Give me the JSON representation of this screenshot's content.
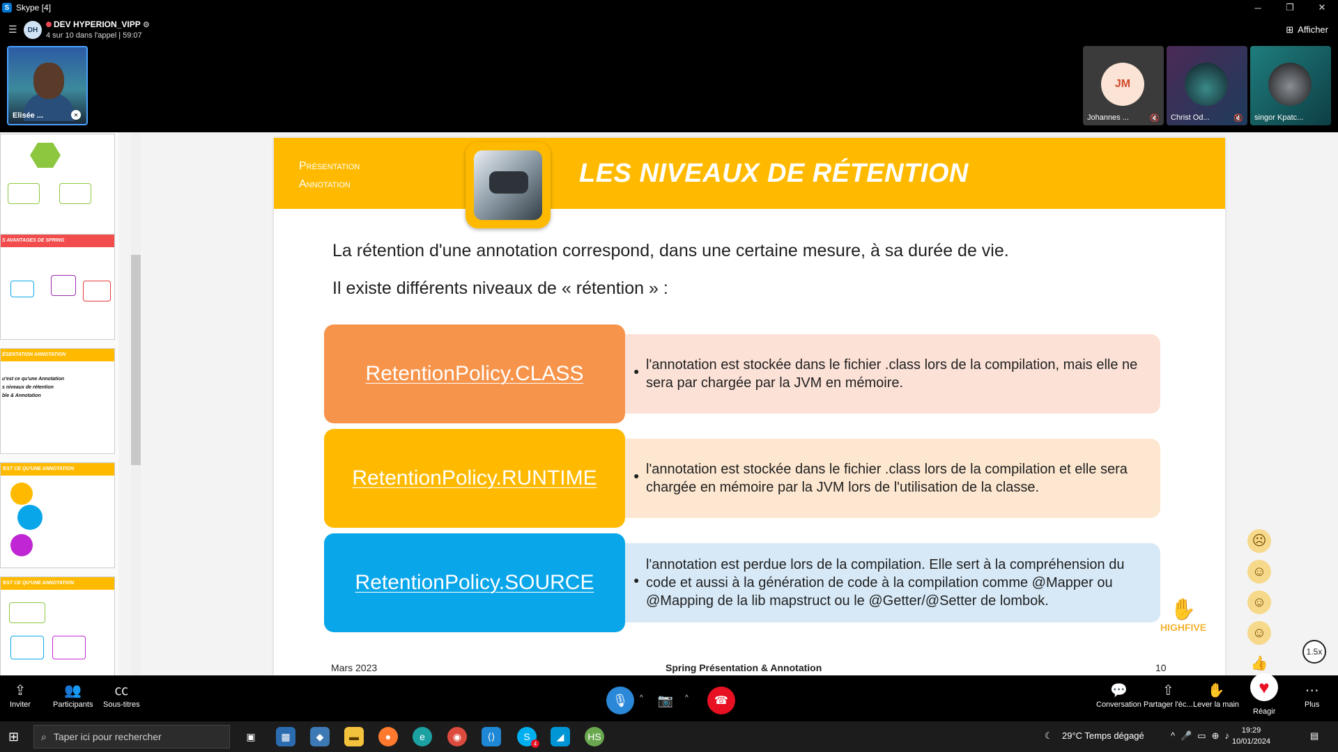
{
  "window": {
    "title": "Skype [4]",
    "controls": [
      "─",
      "❐",
      "✕"
    ]
  },
  "call": {
    "group_avatar": "DH",
    "group_name": "DEV HYPERION_VIPP",
    "status": "4 sur 10 dans l'appel | 59:07",
    "view_button": "Afficher",
    "self_tile_label": "Elisée ...",
    "participants": [
      {
        "initials": "JM",
        "name": "Johannes ..."
      },
      {
        "initials": "",
        "name": "Christ Od..."
      },
      {
        "initials": "",
        "name": "singor Kpatc..."
      }
    ]
  },
  "thumbnails": {
    "bars": [
      "S AVANTAGES DE SPRING",
      "ÉSENTATION ANNOTATION",
      "'EST CE QU'UNE ANNOTATION",
      "'EST CE QU'UNE ANNOTATION"
    ],
    "thumb3_lines": [
      "u'est ce qu'une Annotation",
      "s niveaux de rétention",
      "ble & Annotation"
    ]
  },
  "slide": {
    "section_line1": "Présentation",
    "section_line2": "Annotation",
    "title": "LES NIVEAUX DE RÉTENTION",
    "intro1": "La rétention d'une annotation correspond, dans une certaine mesure, à sa durée de vie.",
    "intro2": "Il existe différents niveaux de « rétention » :",
    "rows": [
      {
        "label": "RetentionPolicy.CLASS",
        "text": "l'annotation est stockée dans le fichier .class lors de la compilation, mais elle ne sera par chargée par la JVM en mémoire."
      },
      {
        "label": "RetentionPolicy.RUNTIME",
        "text": "l'annotation est stockée dans le fichier .class lors de la compilation et elle sera chargée en mémoire par la JVM lors de l'utilisation de la classe."
      },
      {
        "label": "RetentionPolicy.SOURCE",
        "text": "l'annotation est perdue lors de la compilation. Elle sert à la compréhension du code et aussi à la génération de code à la compilation comme @Mapper ou @Mapping de la lib mapstruct ou le @Getter/@Setter de lombok."
      }
    ],
    "footer_date": "Mars 2023",
    "footer_title": "Spring Présentation & Annotation",
    "footer_page": "10",
    "logo_text": "HIGHFIVE"
  },
  "reactions": [
    "☹",
    "☺",
    "☺",
    "☺",
    "👍"
  ],
  "speed": "1.5x",
  "controls": {
    "invite": "Inviter",
    "participants": "Participants",
    "subtitles": "Sous-titres",
    "conversation": "Conversation",
    "share": "Partager l'éc...",
    "raise_hand": "Lever la main",
    "react": "Réagir",
    "more": "Plus"
  },
  "taskbar": {
    "search_placeholder": "Taper ici pour rechercher",
    "weather": "29°C  Temps dégagé",
    "time": "19:29",
    "date": "10/01/2024",
    "skype_badge": "4"
  },
  "colors": {
    "header_yellow": "#ffba00",
    "class_orange": "#f7944b",
    "class_bg": "#fbe1d6",
    "runtime_yellow": "#ffba00",
    "runtime_bg": "#fde7d0",
    "source_blue": "#0aa6ea",
    "source_bg": "#d7e9f7"
  }
}
